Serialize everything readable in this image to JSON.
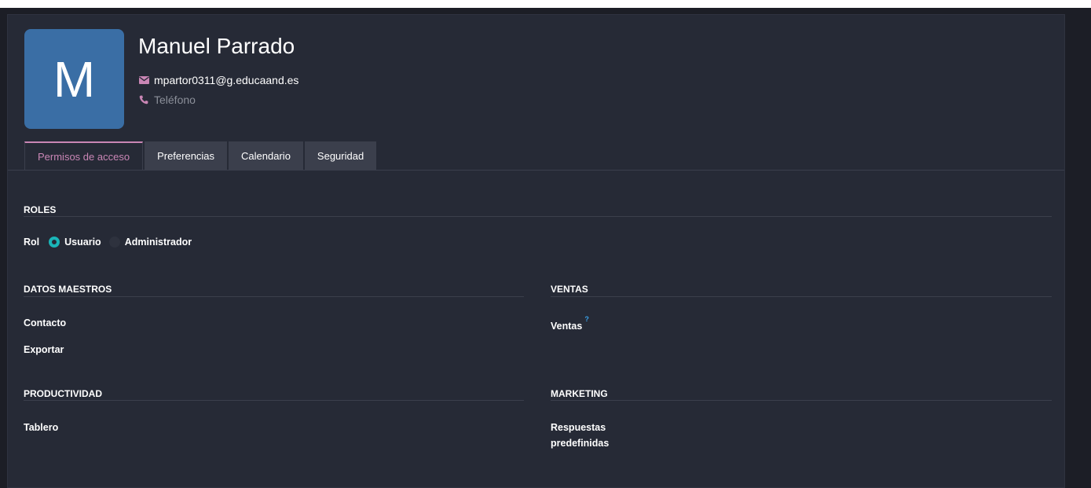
{
  "user": {
    "initial": "M",
    "name": "Manuel Parrado",
    "email": "mpartor0311@g.educaand.es",
    "phone_placeholder": "Teléfono"
  },
  "tabs": [
    {
      "label": "Permisos de acceso",
      "active": true
    },
    {
      "label": "Preferencias",
      "active": false
    },
    {
      "label": "Calendario",
      "active": false
    },
    {
      "label": "Seguridad",
      "active": false
    }
  ],
  "roles": {
    "title": "ROLES",
    "rol_label": "Rol",
    "options": [
      {
        "label": "Usuario",
        "selected": true
      },
      {
        "label": "Administrador",
        "selected": false
      }
    ]
  },
  "datos_maestros": {
    "title": "DATOS MAESTROS",
    "fields": [
      "Contacto",
      "Exportar"
    ]
  },
  "ventas": {
    "title": "VENTAS",
    "field": "Ventas",
    "help": "?"
  },
  "productividad": {
    "title": "PRODUCTIVIDAD",
    "fields": [
      "Tablero"
    ]
  },
  "marketing": {
    "title": "MARKETING",
    "field_line1": "Respuestas",
    "field_line2": "predefinidas"
  },
  "colors": {
    "accent": "#c986b5",
    "radio_on": "#1ab5b8",
    "avatar_bg": "#3a6ea5",
    "help": "#3aa0e8"
  },
  "icons": {
    "email": "envelope-icon",
    "phone": "phone-icon"
  }
}
